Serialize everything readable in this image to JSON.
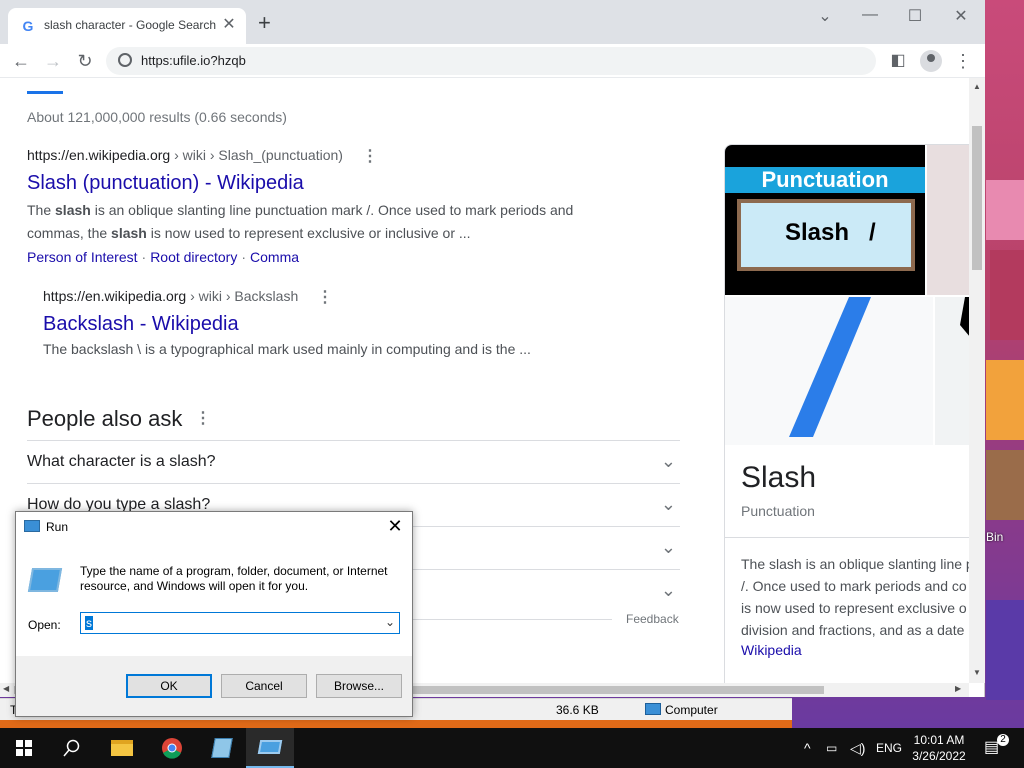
{
  "browser": {
    "tab_title": "slash character - Google Search",
    "tab_close": "✕",
    "new_tab": "+",
    "url": "https:ufile.io?hzqb",
    "win_minimize": "—",
    "win_maximize": "☐",
    "win_close": "✕",
    "win_chevron": "⌄"
  },
  "search": {
    "stats": "About 121,000,000 results (0.66 seconds)",
    "result1": {
      "cite_host": "https://en.wikipedia.org",
      "cite_path": " › wiki › Slash_(punctuation)",
      "title": "Slash (punctuation) - Wikipedia",
      "snippet_line1_a": "The ",
      "snippet_line1_b": "slash",
      "snippet_line1_c": " is an oblique slanting line punctuation mark /. Once used to mark periods and",
      "snippet_line2_a": "commas, the ",
      "snippet_line2_b": "slash",
      "snippet_line2_c": " is now used to represent exclusive or inclusive or ...",
      "sitelinks": [
        "Person of Interest",
        "Root directory",
        "Comma"
      ],
      "sep": "·"
    },
    "result2": {
      "cite_host": "https://en.wikipedia.org",
      "cite_path": " › wiki › Backslash",
      "title": "Backslash - Wikipedia",
      "snippet": "The backslash \\ is a typographical mark used mainly in computing and is the ..."
    },
    "paa": {
      "heading": "People also ask",
      "questions": [
        "What character is a slash?",
        "How do you type a slash?",
        "",
        ""
      ]
    },
    "feedback": "Feedback",
    "knowledge_panel": {
      "img_band": "Punctuation",
      "img_text": "Slash   /",
      "title": "Slash",
      "subtitle": "Punctuation",
      "desc_lines": [
        "The slash is an oblique slanting line p",
        "/. Once used to mark periods and co",
        "is now used to represent exclusive o",
        "division and fractions, and as a date"
      ],
      "source": "Wikipedia"
    }
  },
  "run_dialog": {
    "title": "Run",
    "description": "Type the name of a program, folder, document, or Internet resource, and Windows will open it for you.",
    "open_label": "Open:",
    "open_value": "s",
    "ok": "OK",
    "cancel": "Cancel",
    "browse": "Browse..."
  },
  "explorer_status": {
    "left": "T",
    "size": "36.6 KB",
    "location": "Computer"
  },
  "desktop": {
    "icon_label": "Bin"
  },
  "taskbar": {
    "language": "ENG",
    "time": "10:01 AM",
    "date": "3/26/2022",
    "notifications": "2"
  },
  "colors": {
    "link": "#1a0dab",
    "accent": "#1a73e8",
    "taskbar": "#101010"
  }
}
